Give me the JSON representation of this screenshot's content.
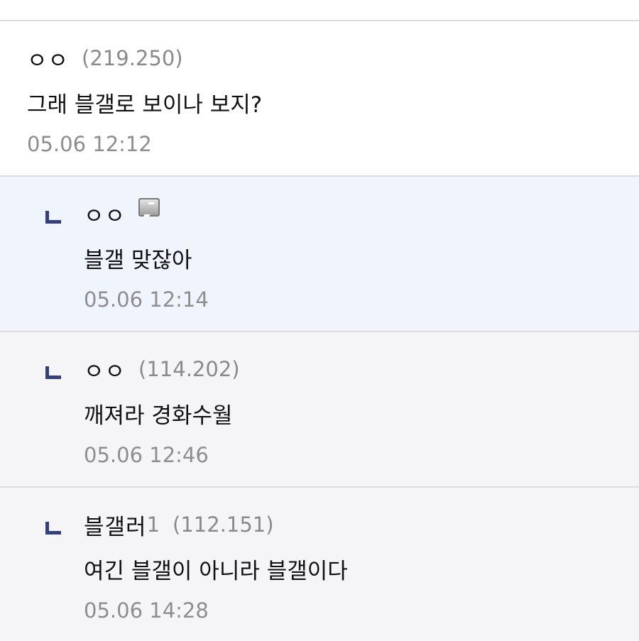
{
  "comments": [
    {
      "nick": "ㅇㅇ",
      "ip": "(219.250)",
      "text": "그래 블갤로 보이나 보지?",
      "time": "05.06 12:12"
    }
  ],
  "replies": [
    {
      "nick": "ㅇㅇ",
      "badge_icon": "fixed-nick-icon",
      "text": "블갤 맞잖아",
      "time": "05.06 12:14"
    },
    {
      "nick": "ㅇㅇ",
      "ip": "(114.202)",
      "text": "깨져라 경화수월",
      "time": "05.06 12:46"
    },
    {
      "nick": "블갤러",
      "nick_suffix": "1",
      "ip": "(112.151)",
      "text": "여긴 블갤이 아니라 블갤이다",
      "time": "05.06 14:28"
    }
  ],
  "colors": {
    "reply_mark": "#34407a",
    "highlight_bg": "#f0f4fd",
    "reply_bg": "#f5f5f7",
    "meta_gray": "#8e8e8e"
  }
}
